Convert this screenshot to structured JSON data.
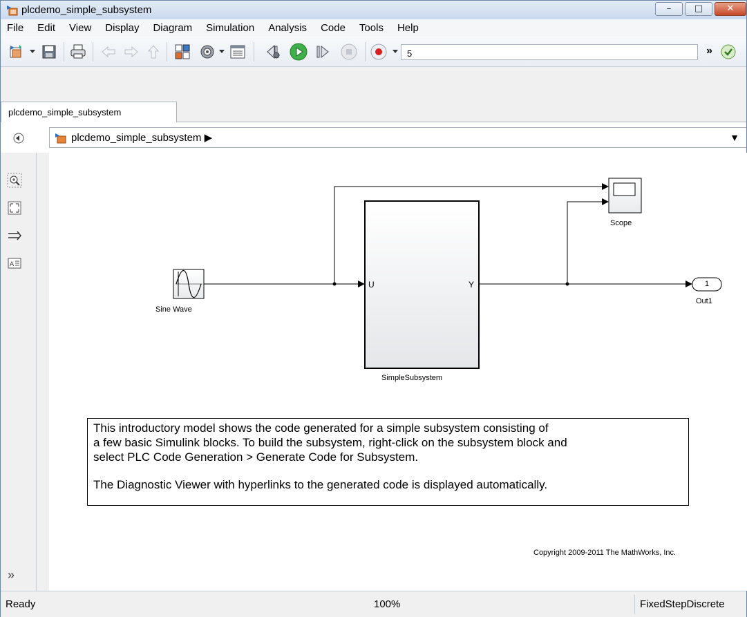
{
  "window": {
    "title": "plcdemo_simple_subsystem",
    "controls": {
      "minimize": "–",
      "maximize": "□",
      "close": "✕"
    }
  },
  "menu": [
    "File",
    "Edit",
    "View",
    "Display",
    "Diagram",
    "Simulation",
    "Analysis",
    "Code",
    "Tools",
    "Help"
  ],
  "toolbar": {
    "stop_time": "5",
    "overflow": "»",
    "icons": [
      "new-model-icon",
      "save-icon",
      "print-icon",
      "back-icon",
      "forward-icon",
      "up-icon",
      "library-browser-icon",
      "model-config-icon",
      "model-explorer-icon",
      "step-back-icon",
      "run-icon",
      "step-forward-icon",
      "stop-icon",
      "record-icon",
      "check-icon"
    ]
  },
  "tab": {
    "label": "plcdemo_simple_subsystem"
  },
  "breadcrumb": {
    "label": "plcdemo_simple_subsystem",
    "arrow": "▶",
    "menu": "▼"
  },
  "palette": {
    "more": "»",
    "icons": [
      "zoom-icon",
      "fit-view-icon",
      "route-lines-icon",
      "annotation-icon"
    ]
  },
  "diagram": {
    "blocks": {
      "sine": "Sine Wave",
      "subsystem": "SimpleSubsystem",
      "subsystem_in": "U",
      "subsystem_out": "Y",
      "scope": "Scope",
      "outport": "Out1",
      "outport_num": "1"
    },
    "annotation": {
      "line1": "This introductory model shows the code generated for a simple subsystem consisting of",
      "line2": "a few basic Simulink blocks.  To build the subsystem, right-click on the subsystem block and",
      "line3": "select PLC Code Generation > Generate Code for Subsystem.",
      "line4": "The Diagnostic Viewer with hyperlinks to the generated code is displayed automatically."
    },
    "copyright": "Copyright 2009-2011 The MathWorks, Inc."
  },
  "status": {
    "left": "Ready",
    "zoom": "100%",
    "solver": "FixedStepDiscrete"
  }
}
